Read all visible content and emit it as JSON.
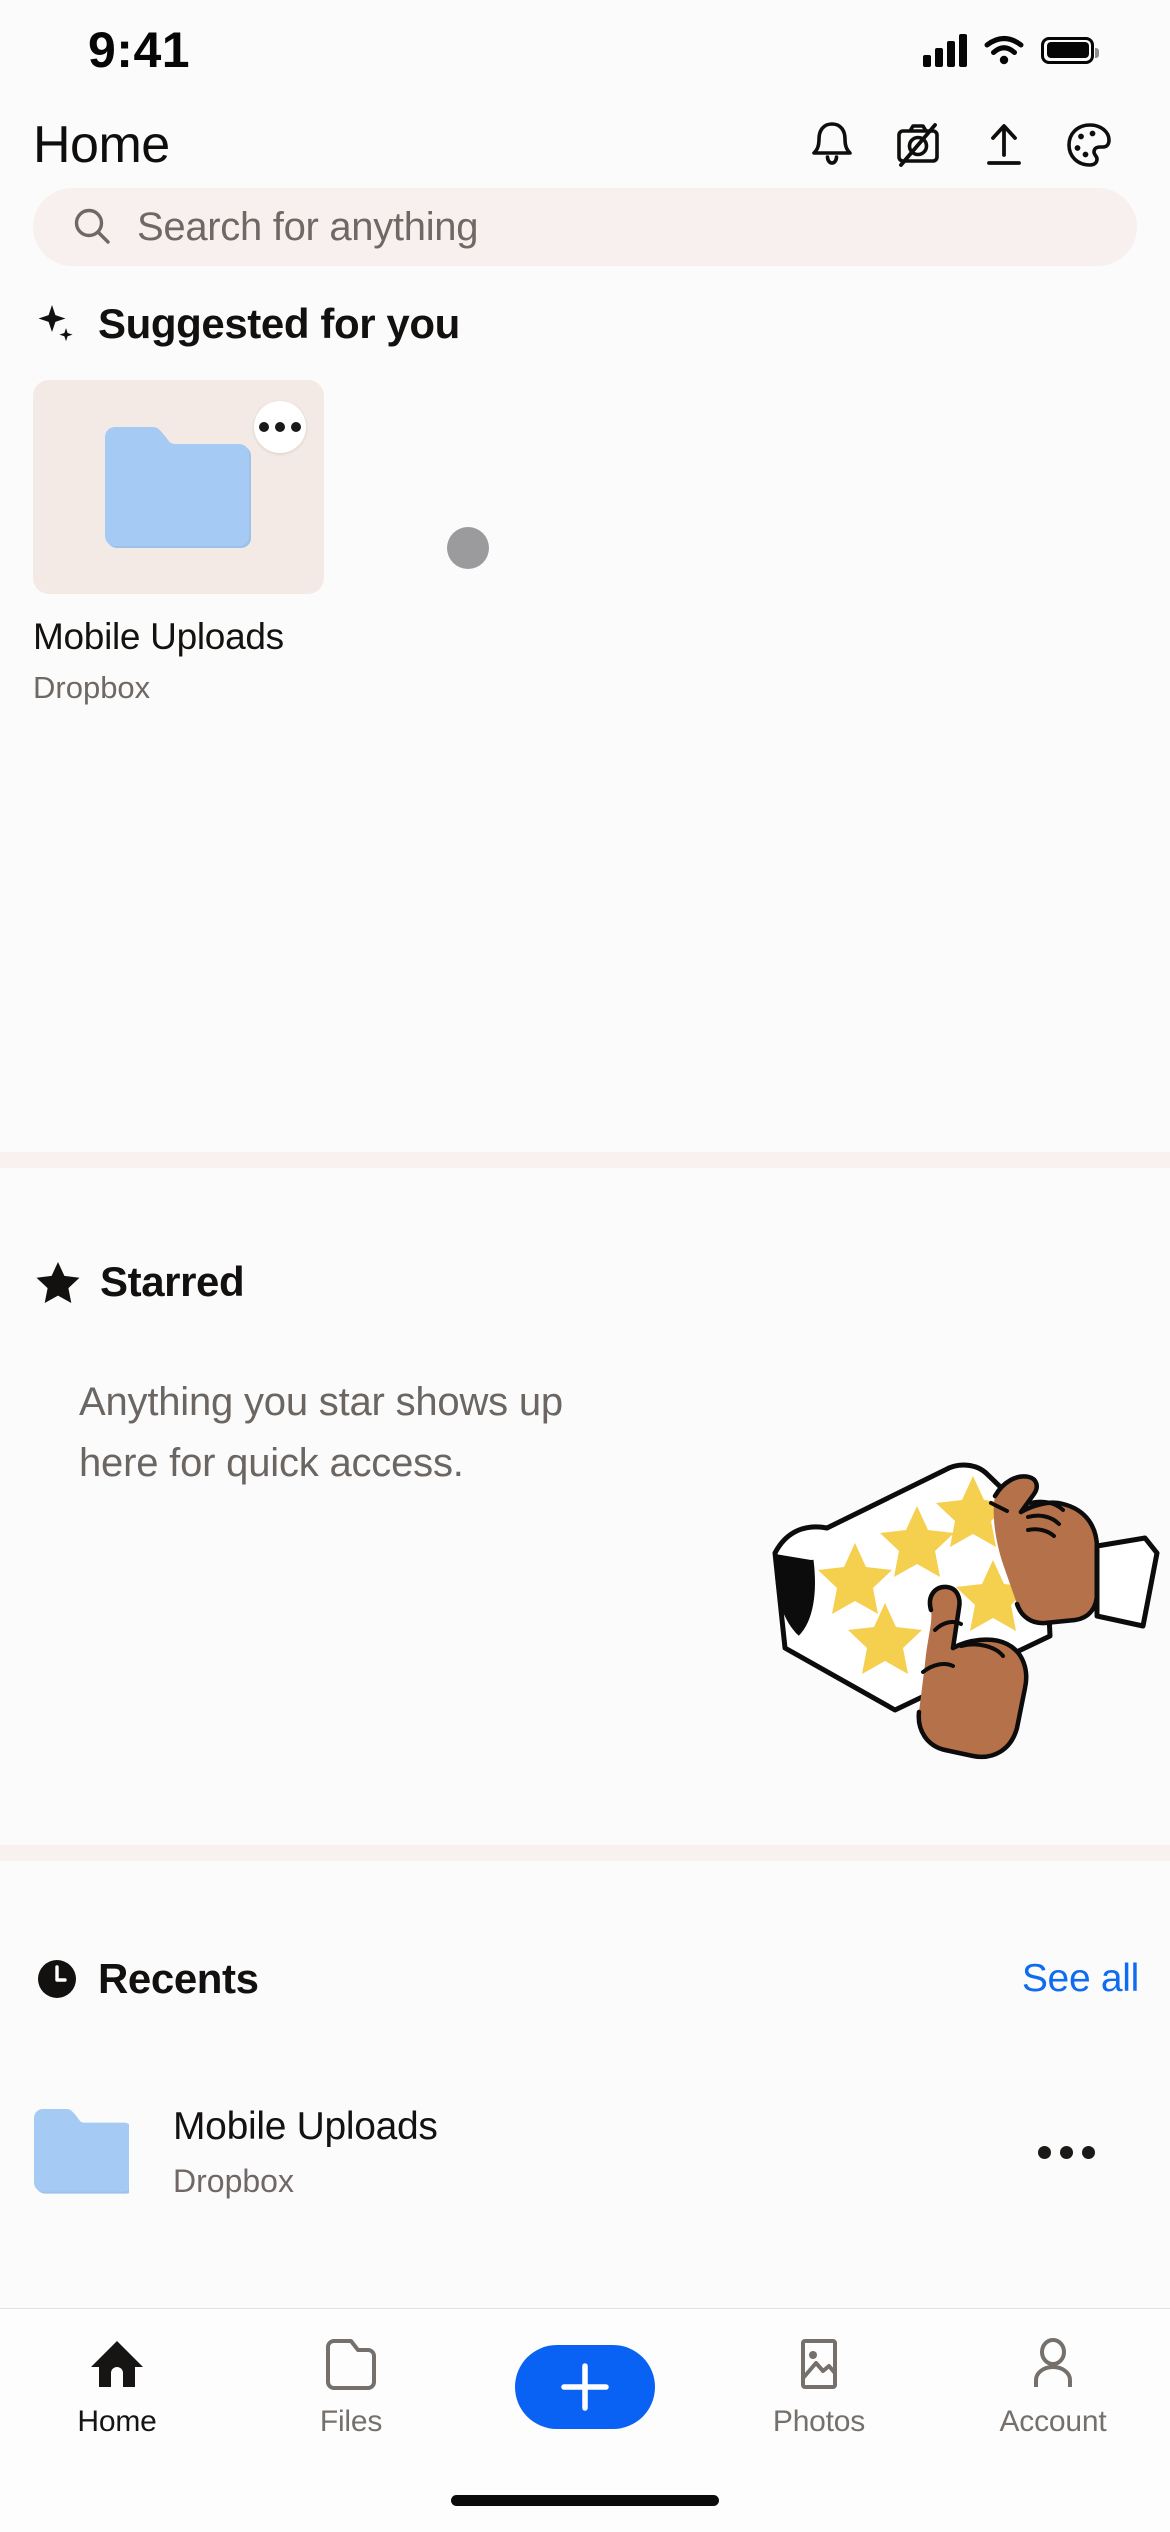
{
  "status_bar": {
    "time": "9:41",
    "cellular_icon": "cellular-signal-icon",
    "wifi_icon": "wifi-icon",
    "battery_icon": "battery-icon"
  },
  "header": {
    "title": "Home",
    "actions": [
      {
        "name": "notifications-icon",
        "label": "Notifications"
      },
      {
        "name": "camera-upload-off-icon",
        "label": "Camera uploads off"
      },
      {
        "name": "upload-icon",
        "label": "Upload"
      },
      {
        "name": "palette-icon",
        "label": "Theme"
      }
    ]
  },
  "search": {
    "icon": "search-icon",
    "placeholder": "Search for anything",
    "value": ""
  },
  "suggested": {
    "icon": "sparkle-icon",
    "title": "Suggested for you",
    "cards": [
      {
        "thumbnail_icon": "folder-icon",
        "name": "Mobile Uploads",
        "subtitle": "Dropbox",
        "overflow_icon": "kebab-menu-icon"
      }
    ],
    "loading_indicator": "loading-dot"
  },
  "starred": {
    "icon": "star-icon",
    "title": "Starred",
    "empty_text": "Anything you star shows up here for quick access.",
    "illustration": "hands-star-stickers-illustration"
  },
  "recents": {
    "icon": "clock-icon",
    "title": "Recents",
    "see_all_label": "See all",
    "items": [
      {
        "icon": "folder-icon",
        "name": "Mobile Uploads",
        "subtitle": "Dropbox",
        "overflow_icon": "kebab-menu-icon"
      }
    ]
  },
  "tabbar": {
    "tabs": [
      {
        "name": "tab-home",
        "label": "Home",
        "icon": "home-icon",
        "active": true
      },
      {
        "name": "tab-files",
        "label": "Files",
        "icon": "folder-outline-icon",
        "active": false
      },
      {
        "name": "tab-create",
        "label": "",
        "icon": "plus-icon",
        "active": false
      },
      {
        "name": "tab-photos",
        "label": "Photos",
        "icon": "photo-icon",
        "active": false
      },
      {
        "name": "tab-account",
        "label": "Account",
        "icon": "person-icon",
        "active": false
      }
    ]
  },
  "colors": {
    "accent_blue": "#0a62f5",
    "link_blue": "#0f6cf0",
    "folder_blue": "#a5cbf4",
    "card_beige": "#f4eae5",
    "search_bg": "#f7f0ee",
    "divider": "#f8f1f0",
    "star_yellow": "#f5cf4e",
    "skin_tone": "#b5714a"
  }
}
